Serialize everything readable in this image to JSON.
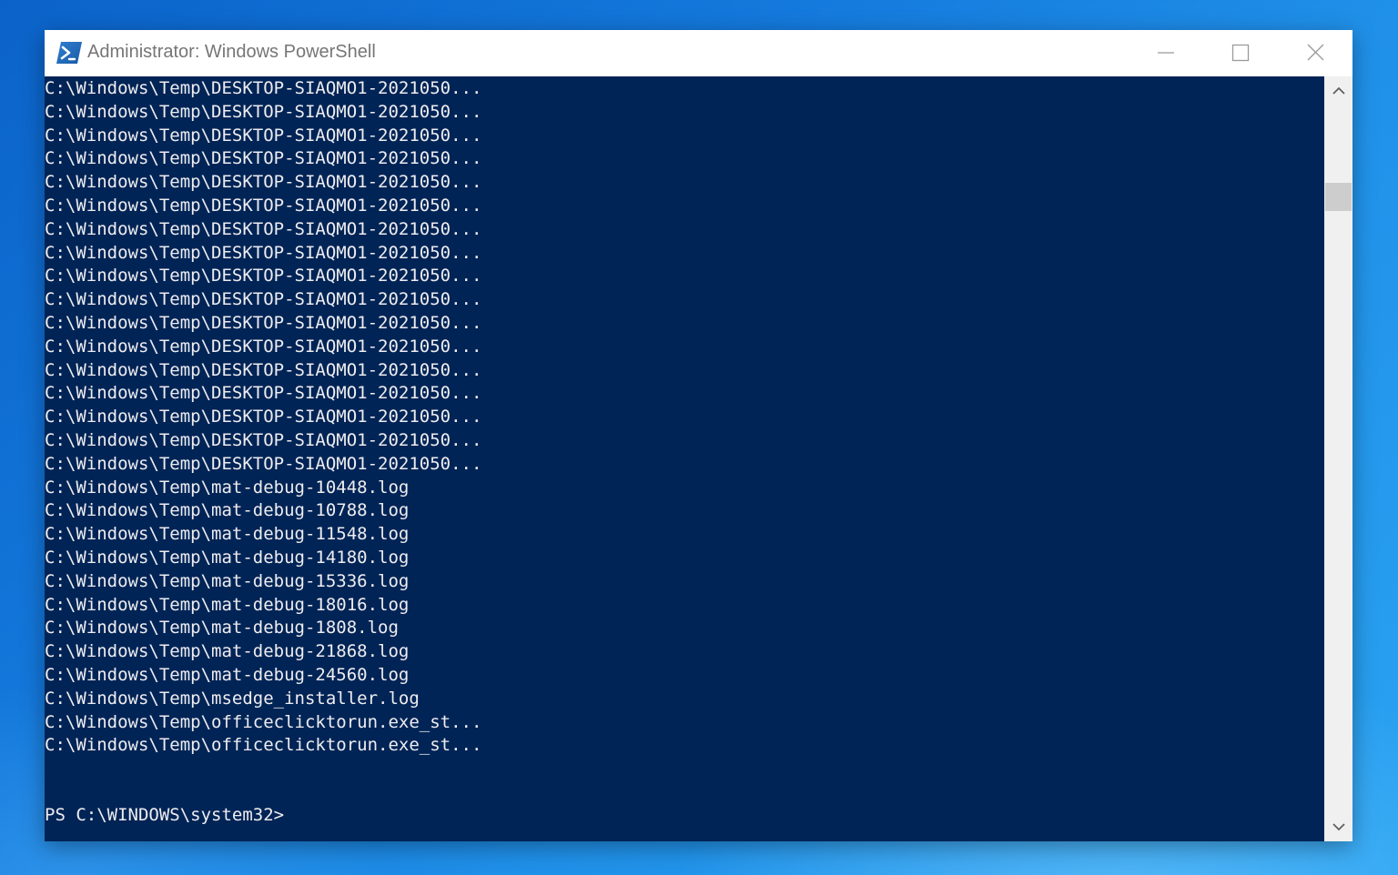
{
  "window": {
    "title": "Administrator: Windows PowerShell",
    "app_icon": "powershell-icon"
  },
  "title_buttons": {
    "minimize_icon": "minimize-icon",
    "maximize_icon": "maximize-icon",
    "close_icon": "close-icon"
  },
  "console": {
    "background": "#012456",
    "foreground": "#eeedf0",
    "lines": [
      "C:\\Windows\\Temp\\DESKTOP-SIAQMO1-2021050...",
      "C:\\Windows\\Temp\\DESKTOP-SIAQMO1-2021050...",
      "C:\\Windows\\Temp\\DESKTOP-SIAQMO1-2021050...",
      "C:\\Windows\\Temp\\DESKTOP-SIAQMO1-2021050...",
      "C:\\Windows\\Temp\\DESKTOP-SIAQMO1-2021050...",
      "C:\\Windows\\Temp\\DESKTOP-SIAQMO1-2021050...",
      "C:\\Windows\\Temp\\DESKTOP-SIAQMO1-2021050...",
      "C:\\Windows\\Temp\\DESKTOP-SIAQMO1-2021050...",
      "C:\\Windows\\Temp\\DESKTOP-SIAQMO1-2021050...",
      "C:\\Windows\\Temp\\DESKTOP-SIAQMO1-2021050...",
      "C:\\Windows\\Temp\\DESKTOP-SIAQMO1-2021050...",
      "C:\\Windows\\Temp\\DESKTOP-SIAQMO1-2021050...",
      "C:\\Windows\\Temp\\DESKTOP-SIAQMO1-2021050...",
      "C:\\Windows\\Temp\\DESKTOP-SIAQMO1-2021050...",
      "C:\\Windows\\Temp\\DESKTOP-SIAQMO1-2021050...",
      "C:\\Windows\\Temp\\DESKTOP-SIAQMO1-2021050...",
      "C:\\Windows\\Temp\\DESKTOP-SIAQMO1-2021050...",
      "C:\\Windows\\Temp\\mat-debug-10448.log",
      "C:\\Windows\\Temp\\mat-debug-10788.log",
      "C:\\Windows\\Temp\\mat-debug-11548.log",
      "C:\\Windows\\Temp\\mat-debug-14180.log",
      "C:\\Windows\\Temp\\mat-debug-15336.log",
      "C:\\Windows\\Temp\\mat-debug-18016.log",
      "C:\\Windows\\Temp\\mat-debug-1808.log",
      "C:\\Windows\\Temp\\mat-debug-21868.log",
      "C:\\Windows\\Temp\\mat-debug-24560.log",
      "C:\\Windows\\Temp\\msedge_installer.log",
      "C:\\Windows\\Temp\\officeclicktorun.exe_st...",
      "C:\\Windows\\Temp\\officeclicktorun.exe_st..."
    ],
    "prompt": "PS C:\\WINDOWS\\system32>"
  },
  "scrollbar": {
    "up_icon": "scroll-up-arrow-icon",
    "down_icon": "scroll-down-arrow-icon"
  }
}
